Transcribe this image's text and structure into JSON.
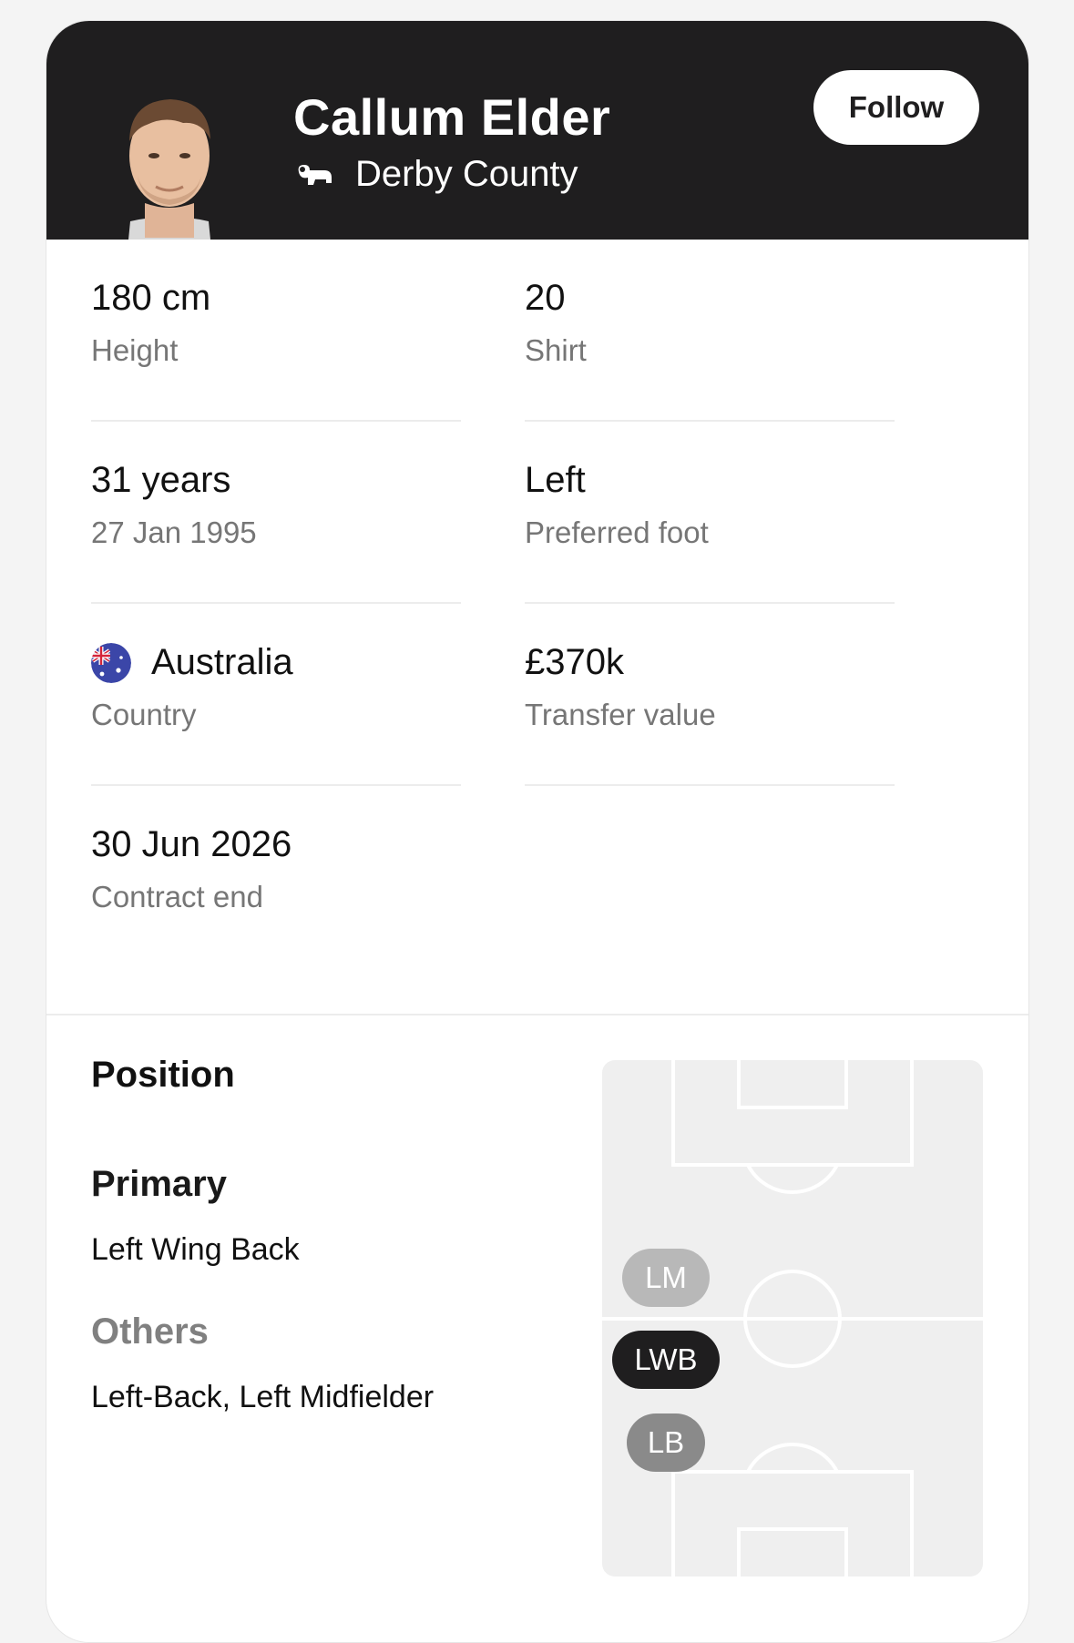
{
  "player": {
    "name": "Callum Elder",
    "team": "Derby County",
    "follow_label": "Follow"
  },
  "stats": {
    "height": {
      "value": "180 cm",
      "label": "Height"
    },
    "shirt": {
      "value": "20",
      "label": "Shirt"
    },
    "age": {
      "value": "31 years",
      "label": "27 Jan 1995"
    },
    "foot": {
      "value": "Left",
      "label": "Preferred foot"
    },
    "country": {
      "value": "Australia",
      "label": "Country"
    },
    "transfer": {
      "value": "£370k",
      "label": "Transfer value"
    },
    "contract": {
      "value": "30 Jun 2026",
      "label": "Contract end"
    }
  },
  "position": {
    "title": "Position",
    "primary_title": "Primary",
    "primary_value": "Left Wing Back",
    "others_title": "Others",
    "others_value": "Left-Back, Left Midfielder",
    "pills": {
      "lm": "LM",
      "lwb": "LWB",
      "lb": "LB"
    }
  },
  "colors": {
    "header_bg": "#1f1e1f",
    "primary_pill": "#1f1e1f",
    "lb_pill": "#8a8a8a",
    "lm_pill": "#b8b8b8"
  },
  "icons": {
    "crest": "derby-ram-crest-icon",
    "flag": "australia-flag-icon"
  }
}
